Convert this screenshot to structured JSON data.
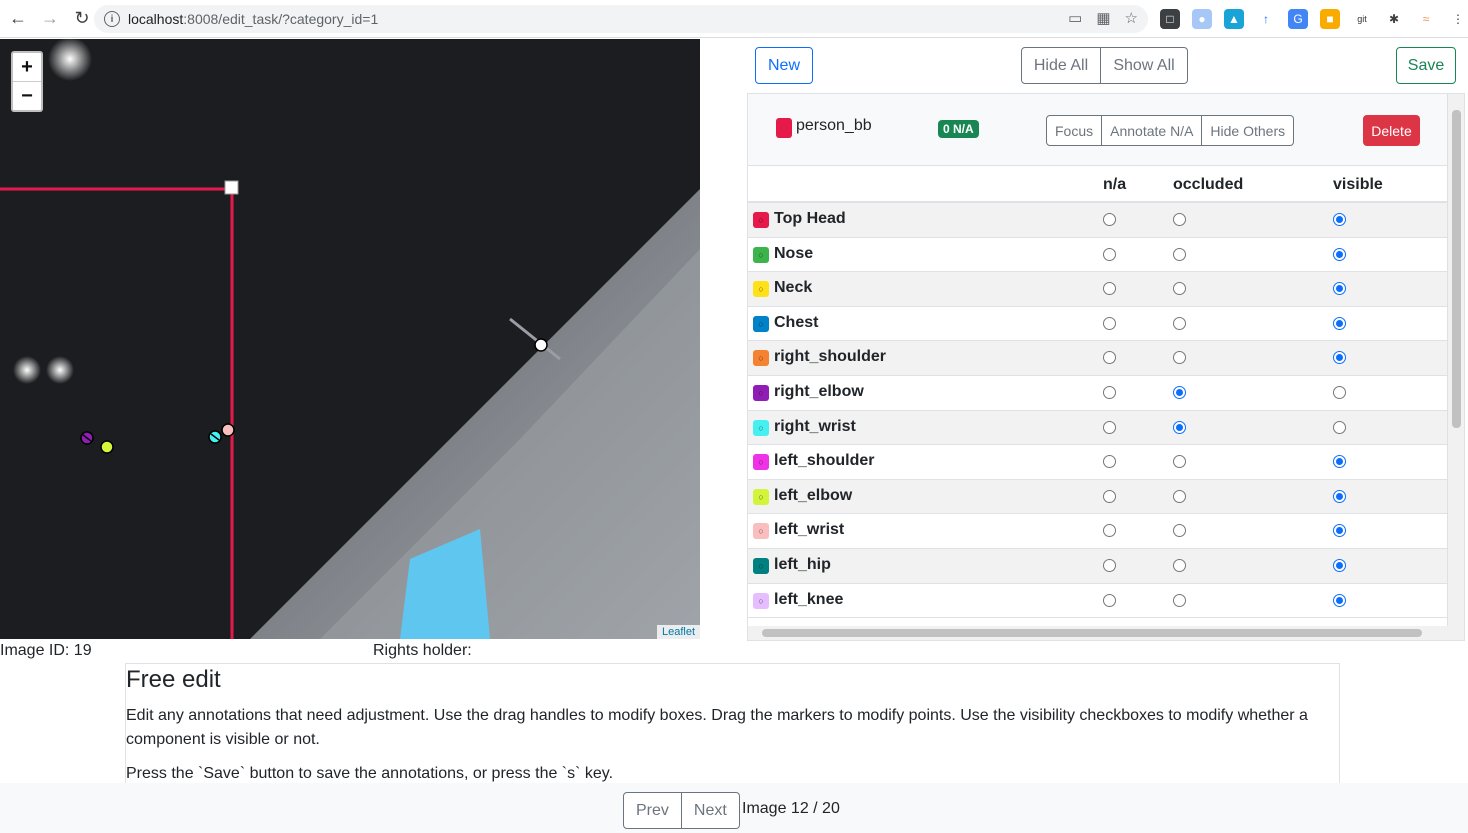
{
  "browser": {
    "url_host": "localhost",
    "url_path": ":8008/edit_task/?category_id=1",
    "back_icon": "arrow-left-icon",
    "forward_icon": "arrow-right-icon",
    "reload_icon": "reload-icon"
  },
  "map": {
    "zoom_in": "+",
    "zoom_out": "−",
    "attribution": "Leaflet"
  },
  "toolbar": {
    "new_label": "New",
    "hide_all_label": "Hide All",
    "show_all_label": "Show All",
    "save_label": "Save"
  },
  "category": {
    "name": "person_bb",
    "color": "#e6194b",
    "badge": "0 N/A",
    "focus_label": "Focus",
    "annotate_na_label": "Annotate N/A",
    "hide_others_label": "Hide Others",
    "delete_label": "Delete"
  },
  "table": {
    "headers": [
      "n/a",
      "occluded",
      "visible"
    ],
    "rows": [
      {
        "name": "Top Head",
        "color": "#e6194b",
        "state": "visible"
      },
      {
        "name": "Nose",
        "color": "#3cb44b",
        "state": "visible"
      },
      {
        "name": "Neck",
        "color": "#ffe119",
        "state": "visible"
      },
      {
        "name": "Chest",
        "color": "#0082c8",
        "state": "visible"
      },
      {
        "name": "right_shoulder",
        "color": "#f58231",
        "state": "visible"
      },
      {
        "name": "right_elbow",
        "color": "#911eb4",
        "state": "occluded"
      },
      {
        "name": "right_wrist",
        "color": "#46f0f0",
        "state": "occluded"
      },
      {
        "name": "left_shoulder",
        "color": "#f032e6",
        "state": "visible"
      },
      {
        "name": "left_elbow",
        "color": "#d2f53c",
        "state": "visible"
      },
      {
        "name": "left_wrist",
        "color": "#fabebe",
        "state": "visible"
      },
      {
        "name": "left_hip",
        "color": "#008080",
        "state": "visible"
      },
      {
        "name": "left_knee",
        "color": "#e6beff",
        "state": "visible"
      }
    ]
  },
  "meta": {
    "image_id": "Image ID: 19",
    "rights_holder": "Rights holder:"
  },
  "description": {
    "title": "Free edit",
    "p1": "Edit any annotations that need adjustment. Use the drag handles to modify boxes. Drag the markers to modify points. Use the visibility checkboxes to modify whether a component is visible or not.",
    "p2": "Press the `Save` button to save the annotations, or press the `s` key."
  },
  "footer": {
    "prev_label": "Prev",
    "next_label": "Next",
    "image_count": "Image 12 / 20"
  }
}
